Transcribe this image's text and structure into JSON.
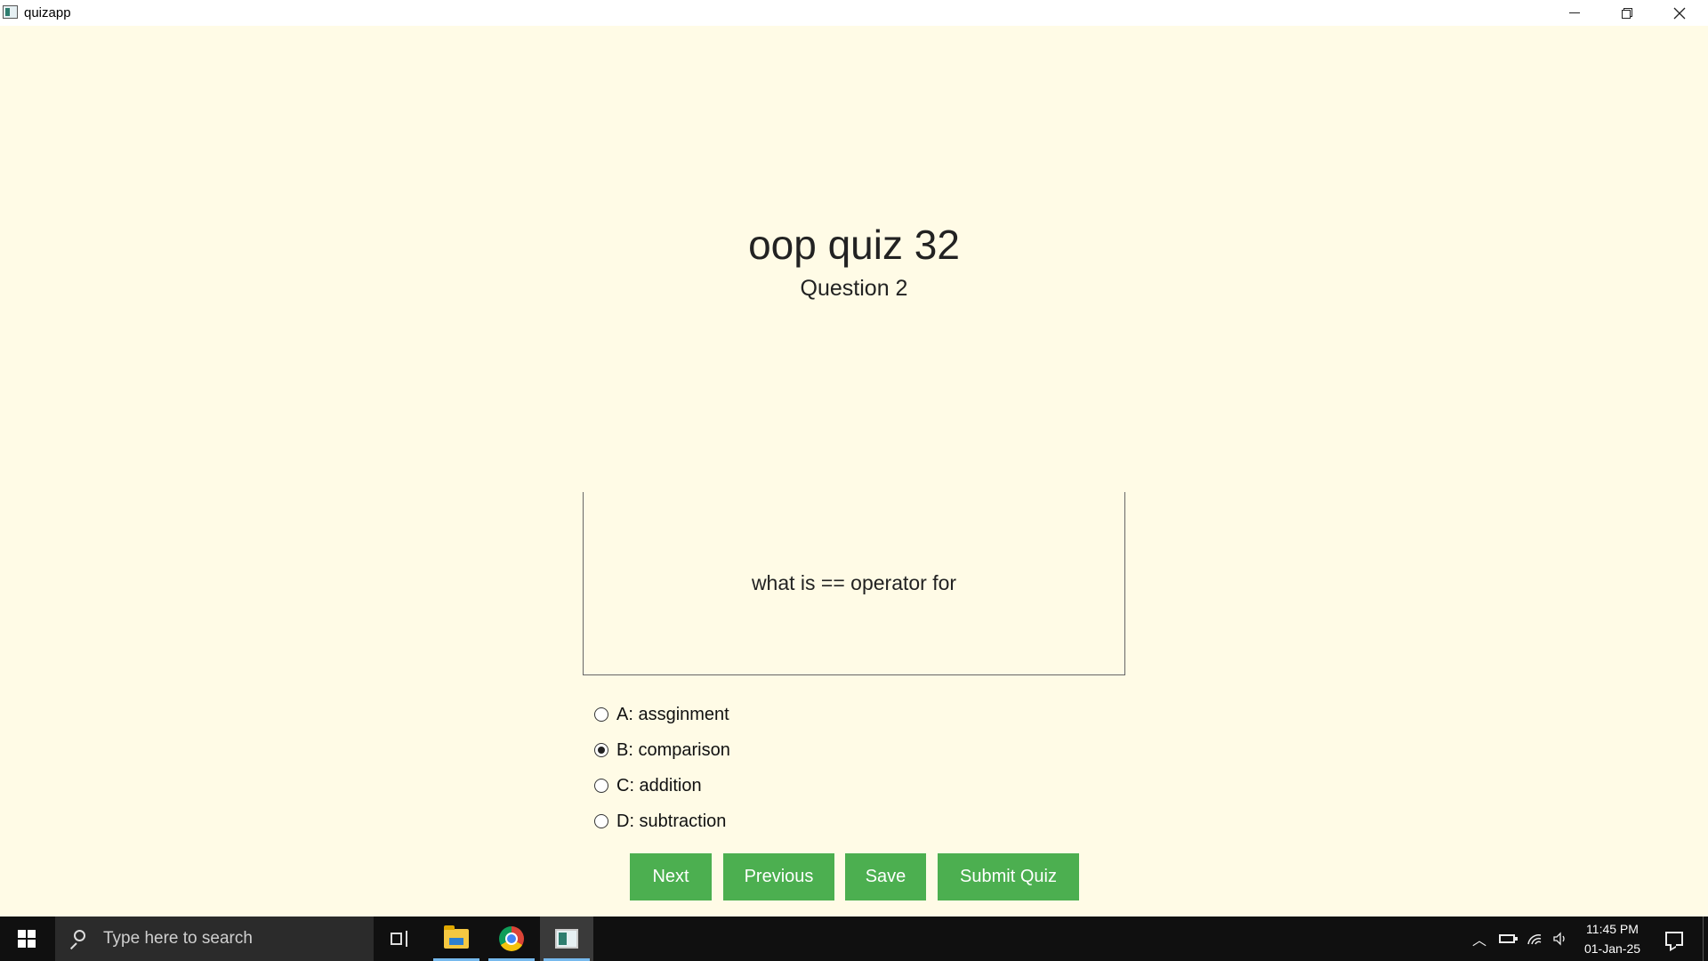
{
  "window": {
    "title": "quizapp",
    "icon": "quizapp-icon",
    "controls": [
      "minimize",
      "restore",
      "close"
    ]
  },
  "quiz": {
    "title": "oop quiz 32",
    "question_number": "Question 2",
    "question_text": "what is == operator for",
    "options": [
      {
        "label": "A: assginment",
        "selected": false
      },
      {
        "label": "B: comparison",
        "selected": true
      },
      {
        "label": "C: addition",
        "selected": false
      },
      {
        "label": "D: subtraction",
        "selected": false
      }
    ]
  },
  "buttons": {
    "next": "Next",
    "previous": "Previous",
    "save": "Save",
    "submit": "Submit Quiz"
  },
  "colors": {
    "background": "#fffbe6",
    "button": "#4caf50",
    "taskbar": "#101010"
  },
  "taskbar": {
    "search_placeholder": "Type here to search",
    "apps": [
      "task-view",
      "file-explorer",
      "chrome",
      "quizapp"
    ],
    "active_app": "quizapp",
    "tray_icons": [
      "chevron-up",
      "battery",
      "network",
      "volume"
    ],
    "time": "11:45 PM",
    "date": "01-Jan-25"
  }
}
